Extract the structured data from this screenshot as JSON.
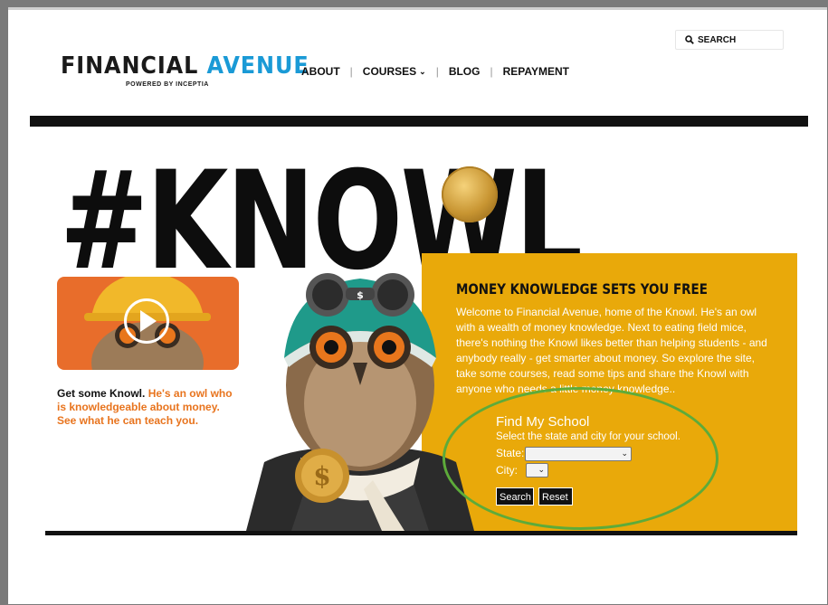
{
  "logo": {
    "word1": "FINANCIAL",
    "word2": "AVENUE",
    "tagline": "POWERED BY INCEPTIA",
    "brand_color": "#1a9ad6"
  },
  "search": {
    "label": "SEARCH",
    "icon": "search-icon"
  },
  "nav": {
    "items": [
      {
        "label": "ABOUT"
      },
      {
        "label": "COURSES",
        "icon": "chevron-down-icon"
      },
      {
        "label": "BLOG"
      },
      {
        "label": "REPAYMENT"
      }
    ]
  },
  "hero": {
    "headline": "#KNOWL"
  },
  "panel": {
    "title": "MONEY KNOWLEDGE SETS YOU FREE",
    "body": "Welcome to Financial Avenue, home of the Knowl. He's an owl with a wealth of money knowledge. Next to eating field mice, there's nothing the Knowl likes better than helping students - and anybody really - get smarter about money. So explore the site, take some courses, read some tips and share the Knowl with anyone who needs a little money knowledge..",
    "background": "#e9a90a"
  },
  "find_school": {
    "title": "Find My School",
    "subtitle": "Select the state and city for your school.",
    "state_label": "State:",
    "state_value": "",
    "city_label": "City:",
    "city_value": "",
    "search_button": "Search",
    "reset_button": "Reset"
  },
  "video": {
    "icon": "play-icon"
  },
  "caption": {
    "lead": "Get some Knowl.",
    "rest": "He's an owl who is knowledgeable about money. See what he can teach you.",
    "accent": "#e8741e"
  }
}
